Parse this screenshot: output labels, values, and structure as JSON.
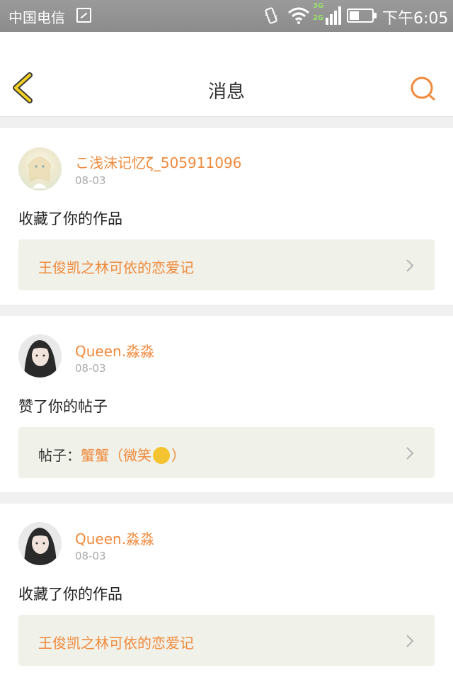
{
  "status_bar": {
    "carrier": "中国电信",
    "network_3g": "3G",
    "network_2g": "2G",
    "time": "下午6:05"
  },
  "nav": {
    "title": "消息",
    "back_icon": "chevron-left-icon",
    "search_icon": "search-icon",
    "accent_color": "#f08a3c"
  },
  "messages": [
    {
      "user": "こ浅沫记忆ζ_505911096",
      "date": "08-03",
      "action": "收藏了你的作品",
      "ref_prefix": "",
      "ref_title": "王俊凯之林可依的恋爱记"
    },
    {
      "user": "Queen.淼淼",
      "date": "08-03",
      "action": "赞了你的帖子",
      "ref_prefix": "帖子：",
      "ref_title": "蟹蟹（微笑",
      "ref_suffix": "）"
    },
    {
      "user": "Queen.淼淼",
      "date": "08-03",
      "action": "收藏了你的作品",
      "ref_prefix": "",
      "ref_title": "王俊凯之林可依的恋爱记"
    }
  ]
}
